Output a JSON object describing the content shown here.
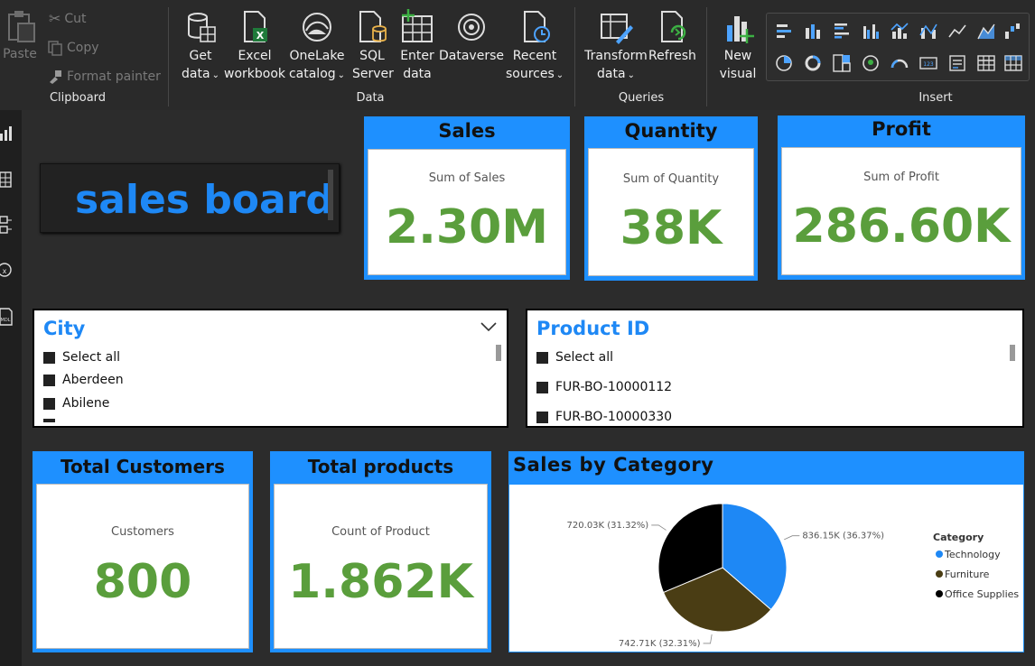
{
  "ribbon": {
    "clipboard": {
      "paste": "Paste",
      "cut": "Cut",
      "copy": "Copy",
      "format_painter": "Format painter",
      "label": "Clipboard"
    },
    "data": {
      "label": "Data",
      "get_data": [
        "Get",
        "data"
      ],
      "excel": [
        "Excel",
        "workbook"
      ],
      "onelake": [
        "OneLake",
        "catalog"
      ],
      "sql": [
        "SQL",
        "Server"
      ],
      "enter": [
        "Enter",
        "data"
      ],
      "dataverse": "Dataverse",
      "recent": [
        "Recent",
        "sources"
      ]
    },
    "queries": {
      "label": "Queries",
      "transform": [
        "Transform",
        "data"
      ],
      "refresh": "Refresh"
    },
    "insert": {
      "label": "Insert",
      "new_visual": [
        "New",
        "visual"
      ]
    }
  },
  "report": {
    "title": "sales board",
    "kpis": {
      "sales": {
        "header": "Sales",
        "sub": "Sum of Sales",
        "value": "2.30M"
      },
      "quantity": {
        "header": "Quantity",
        "sub": "Sum of Quantity",
        "value": "38K"
      },
      "profit": {
        "header": "Profit",
        "sub": "Sum of Profit",
        "value": "286.60K"
      },
      "customers": {
        "header": "Total Customers",
        "sub": "Customers",
        "value": "800"
      },
      "products": {
        "header": "Total products",
        "sub": "Count of Product",
        "value": "1.862K"
      }
    },
    "city_slicer": {
      "title": "City",
      "items": [
        "Select all",
        "Aberdeen",
        "Abilene"
      ]
    },
    "product_slicer": {
      "title": "Product ID",
      "items": [
        "Select all",
        "FUR-BO-10000112",
        "FUR-BO-10000330"
      ]
    }
  },
  "chart_data": {
    "type": "pie",
    "title": "Sales by Category",
    "legend_title": "Category",
    "legend_position": "right",
    "slices": [
      {
        "name": "Technology",
        "value": 836.15,
        "label": "836.15K (36.37%)",
        "color": "#1e88f5"
      },
      {
        "name": "Furniture",
        "value": 742.71,
        "label": "742.71K (32.31%)",
        "color": "#4a3d14"
      },
      {
        "name": "Office Supplies",
        "value": 720.03,
        "label": "720.03K (31.32%)",
        "color": "#000000"
      }
    ]
  },
  "colors": {
    "accent": "#1e90ff",
    "kpi_value": "#5a9e3c",
    "title": "#1e88f5"
  }
}
